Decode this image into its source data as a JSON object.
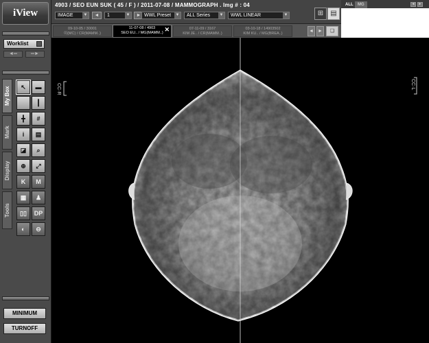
{
  "app": {
    "logo": "iView"
  },
  "header": {
    "patient_line": "4903  /  SEO EUN SUK ( 45  /  F )  /  2011-07-08  /  MAMMOGRAPH .    Img # : 04",
    "image_type": "IMAGE",
    "frame_number": "1",
    "wwl_preset": "WWL Preset",
    "series": "ALL Series",
    "wwl_mode": "WWL LINEAR"
  },
  "right_panel": {
    "tabs": [
      "ALL",
      "MG"
    ]
  },
  "study_tabs": [
    {
      "line1": "09-10-05 / 30001",
      "line2": "이(MC) / CR(MAMM..)",
      "active": false
    },
    {
      "line1": "11-07-08 / 4903",
      "line2": "SEO EU.. / MG(MAMM..)",
      "active": true
    },
    {
      "line1": "07-11-09 / 3167",
      "line2": "KIM JE.. / CR(MAMM..)",
      "active": false
    },
    {
      "line1": "03-10-18 / 14903502",
      "line2": "KIM KU.. / MG(BREA..)",
      "active": false
    }
  ],
  "sidebar": {
    "worklist_label": "Worklist",
    "vtabs": [
      "My Box",
      "Mark",
      "Display",
      "Tools"
    ],
    "tools": [
      {
        "name": "pointer-tool-icon",
        "glyph": "↖"
      },
      {
        "name": "save-tool-icon",
        "glyph": "▬"
      },
      {
        "name": "layout-1x1-icon",
        "glyph": ""
      },
      {
        "name": "layout-1x2-icon",
        "glyph": "┃"
      },
      {
        "name": "layout-2x2-icon",
        "glyph": "╋"
      },
      {
        "name": "layout-3x3-icon",
        "glyph": "#"
      },
      {
        "name": "info-tool-icon",
        "glyph": "i"
      },
      {
        "name": "document-tool-icon",
        "glyph": "▤"
      },
      {
        "name": "window-level-icon",
        "glyph": "◪"
      },
      {
        "name": "zoom-tool-icon",
        "glyph": "⌕"
      },
      {
        "name": "magnify-tool-icon",
        "glyph": "⊕"
      },
      {
        "name": "fit-tool-icon",
        "glyph": "⤢"
      },
      {
        "name": "k-marker-icon",
        "glyph": "K"
      },
      {
        "name": "m-marker-icon",
        "glyph": "M"
      },
      {
        "name": "ruler-tool-icon",
        "glyph": "▦"
      },
      {
        "name": "annotation-tool-icon",
        "glyph": "♟"
      },
      {
        "name": "compare-tool-icon",
        "glyph": "▯▯"
      },
      {
        "name": "dp-tool-icon",
        "glyph": "DP"
      },
      {
        "name": "invert-tool-icon",
        "glyph": "◐"
      },
      {
        "name": "reset-tool-icon",
        "glyph": "⊖"
      }
    ],
    "minimum_label": "MINIMUM",
    "turnoff_label": "TURNOFF"
  },
  "viewer": {
    "left_orient": "CC·R",
    "right_orient": "CC·L"
  }
}
